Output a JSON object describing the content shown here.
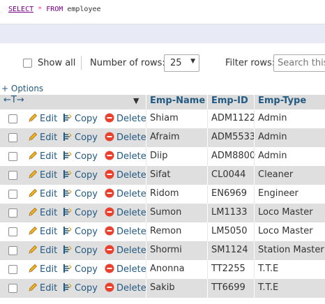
{
  "query": {
    "select_kw": "SELECT",
    "star": "*",
    "from_kw": "FROM",
    "table": "employee"
  },
  "nav": {
    "show_all_label": "Show all",
    "rows_label": "Number of rows:",
    "rows_value": "25",
    "filter_label": "Filter rows:",
    "filter_placeholder": "Search this"
  },
  "options_label": "+ Options",
  "table": {
    "columns": [
      "Emp-Name",
      "Emp-ID",
      "Emp-Type"
    ],
    "actions": {
      "edit": "Edit",
      "copy": "Copy",
      "delete": "Delete"
    },
    "rows": [
      {
        "name": "Shiam",
        "id": "ADM1122",
        "type": "Admin"
      },
      {
        "name": "Afraim",
        "id": "ADM5533",
        "type": "Admin"
      },
      {
        "name": "Diip",
        "id": "ADM8800",
        "type": "Admin"
      },
      {
        "name": "Sifat",
        "id": "CL0044",
        "type": "Cleaner"
      },
      {
        "name": "Ridom",
        "id": "EN6969",
        "type": "Engineer"
      },
      {
        "name": "Sumon",
        "id": "LM1133",
        "type": "Loco Master"
      },
      {
        "name": "Remon",
        "id": "LM5050",
        "type": "Loco Master"
      },
      {
        "name": "Shormi",
        "id": "SM1124",
        "type": "Station Master"
      },
      {
        "name": "Anonna",
        "id": "TT2255",
        "type": "T.T.E"
      },
      {
        "name": "Sakib",
        "id": "TT6699",
        "type": "T.T.E"
      }
    ]
  },
  "colors": {
    "link": "#235a81",
    "row_alt": "#dfdfdf",
    "delete_red": "#e8412e",
    "pencil": "#e0a21b"
  }
}
